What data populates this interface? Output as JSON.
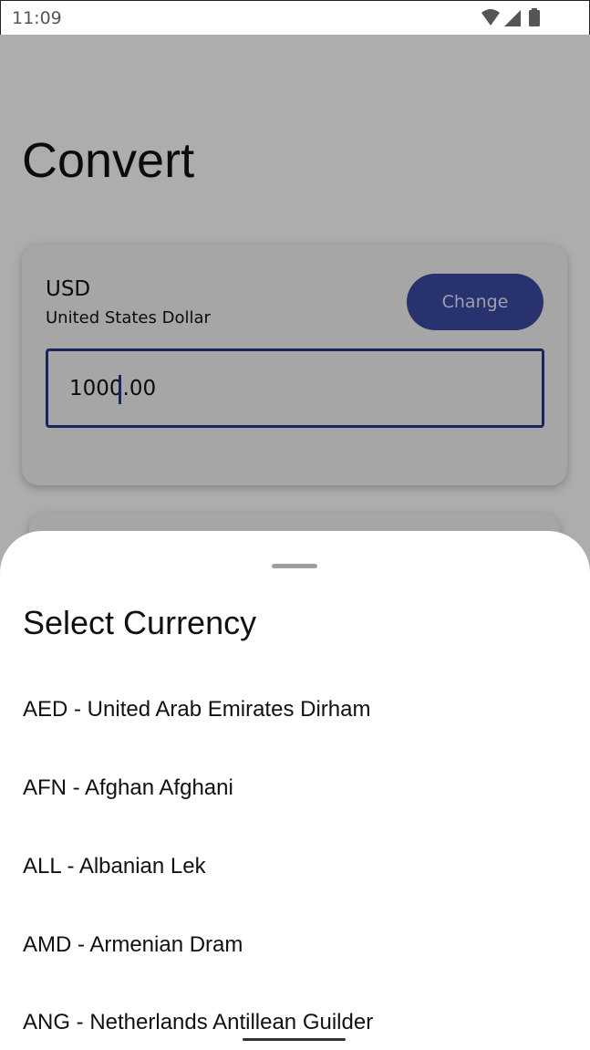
{
  "status_bar": {
    "time": "11:09",
    "icons": [
      "wifi-icon",
      "signal-icon",
      "battery-icon"
    ]
  },
  "page": {
    "title": "Convert"
  },
  "from_card": {
    "code": "USD",
    "name": "United States Dollar",
    "change_label": "Change",
    "amount_value": "1000.00"
  },
  "sheet": {
    "title": "Select Currency",
    "items": [
      "AED - United Arab Emirates Dirham",
      "AFN - Afghan Afghani",
      "ALL - Albanian Lek",
      "AMD - Armenian Dram",
      "ANG - Netherlands Antillean Guilder"
    ]
  },
  "colors": {
    "accent": "#3b4aa2",
    "field_border": "#2a368a",
    "scrim": "rgba(0,0,0,0.32)"
  }
}
